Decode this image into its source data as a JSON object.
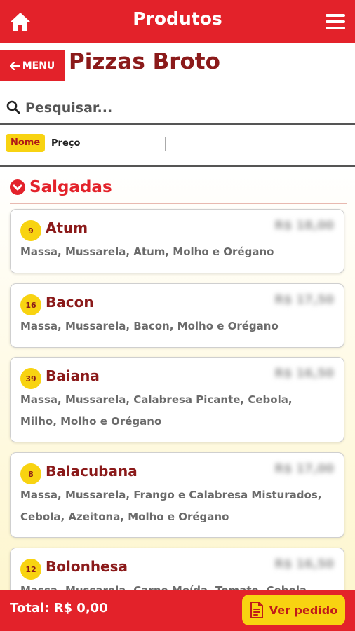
{
  "header": {
    "title": "Produtos",
    "home_icon": "home-icon",
    "menu_icon": "hamburger-icon"
  },
  "breadcrumb": {
    "back_label": "MENU",
    "category_title": "Pizzas Broto"
  },
  "search": {
    "placeholder": "Pesquisar...",
    "value": ""
  },
  "sort": {
    "name_label": "Nome",
    "price_label": "Preço",
    "active": "Nome"
  },
  "section": {
    "title": "Salgadas",
    "expanded": true
  },
  "products": [
    {
      "number": "9",
      "name": "Atum",
      "price": "R$ 18,00",
      "description": "Massa, Mussarela, Atum, Molho e Orégano"
    },
    {
      "number": "16",
      "name": "Bacon",
      "price": "R$ 17,50",
      "description": "Massa, Mussarela, Bacon, Molho e Orégano"
    },
    {
      "number": "39",
      "name": "Baiana",
      "price": "R$ 16,50",
      "description": "Massa, Mussarela, Calabresa Picante, Cebola, Milho, Molho e Orégano"
    },
    {
      "number": "8",
      "name": "Balacubana",
      "price": "R$ 17,00",
      "description": "Massa, Mussarela, Frango e Calabresa Misturados, Cebola, Azeitona, Molho e Orégano"
    },
    {
      "number": "12",
      "name": "Bolonhesa",
      "price": "R$ 16,50",
      "description": "Massa, Mussarela, Carne Moída, Tomate, Cebola"
    }
  ],
  "footer": {
    "total_label": "Total: R$ 0,00",
    "order_button": "Ver pedido",
    "order_icon": "document-icon"
  },
  "colors": {
    "primary_red": "#e3222a",
    "dark_red": "#8b1a1a",
    "accent_yellow": "#f8d311"
  }
}
